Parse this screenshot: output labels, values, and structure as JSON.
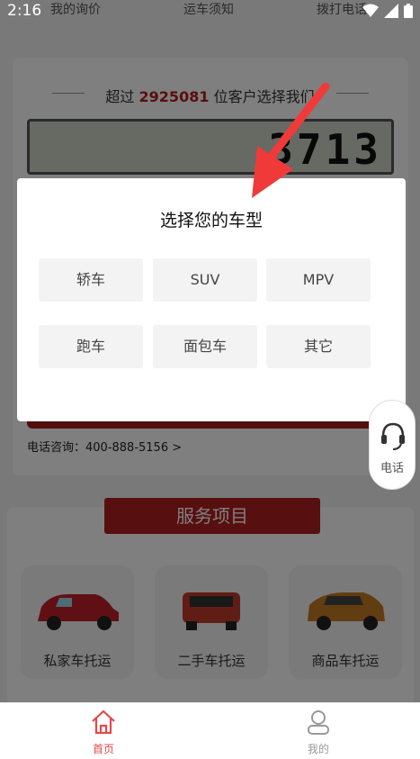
{
  "status_bar": {
    "time": "2:16"
  },
  "top_nav": {
    "items": [
      "我的询价",
      "运车须知",
      "拨打电话"
    ]
  },
  "stats": {
    "prefix": "超过",
    "count": "2925081",
    "suffix": "位客户选择我们",
    "counter_digits": "3713"
  },
  "contact": {
    "phone_text": "电话咨询：400-888-5156 >"
  },
  "services": {
    "banner": "服务项目",
    "items": [
      {
        "label": "私家车托运",
        "color": "#c0202a"
      },
      {
        "label": "二手车托运",
        "color": "#c03a2a"
      },
      {
        "label": "商品车托运",
        "color": "#c57a22"
      }
    ]
  },
  "modal": {
    "title": "选择您的车型",
    "options": [
      "轿车",
      "SUV",
      "MPV",
      "跑车",
      "面包车",
      "其它"
    ]
  },
  "float_button": {
    "label": "电话"
  },
  "tabbar": {
    "tabs": [
      {
        "label": "首页",
        "active": true,
        "color": "#e24a4a"
      },
      {
        "label": "我的",
        "active": false,
        "color": "#999999"
      }
    ]
  }
}
